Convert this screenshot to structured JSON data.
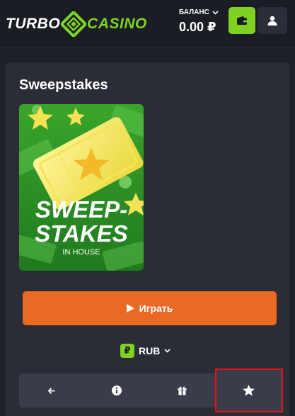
{
  "header": {
    "logo_left": "TURBO",
    "logo_right": "CASINO",
    "balance_label": "БАЛАНС",
    "balance_value": "0.00 ₽"
  },
  "page": {
    "title": "Sweepstakes"
  },
  "game": {
    "art_title_line1": "SWEEP-",
    "art_title_line2": "STAKES",
    "art_subtitle": "IN HOUSE"
  },
  "play": {
    "label": "Играть"
  },
  "currency": {
    "symbol": "₽",
    "code": "RUB"
  },
  "actions": {
    "items": [
      "back-arrow-icon",
      "info-icon",
      "gift-icon",
      "star-icon"
    ],
    "selected_index": 3
  },
  "colors": {
    "accent_green": "#7ed321",
    "play_orange": "#ea6a23",
    "highlight_red": "#e0141c",
    "background": "#1f2128",
    "panel": "#2b2d36"
  }
}
